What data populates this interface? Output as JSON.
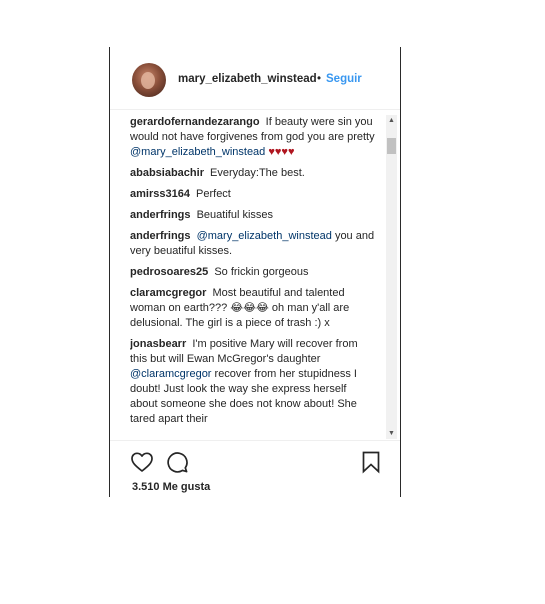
{
  "header": {
    "username": "mary_elizabeth_winstead",
    "separator": "•",
    "follow_label": "Seguir"
  },
  "comments": [
    {
      "author": "gerardofernandezarango",
      "text": "If beauty were sin you would not have forgivenes from god you are pretty",
      "mention": "@mary_elizabeth_winstead",
      "hearts": "♥♥♥♥"
    },
    {
      "author": "ababsiabachir",
      "text": "Everyday:The best."
    },
    {
      "author": "amirss3164",
      "text": "Perfect"
    },
    {
      "author": "anderfrings",
      "text": "Beuatiful kisses"
    },
    {
      "author": "anderfrings",
      "mention": "@mary_elizabeth_winstead",
      "text": "you and very beuatiful kisses."
    },
    {
      "author": "pedrosoares25",
      "text": "So frickin gorgeous"
    },
    {
      "author": "claramcgregor",
      "text": "Most beautiful and talented woman on earth??? 😂😂😂 oh man y'all are delusional. The girl is a piece of trash :) x"
    },
    {
      "author": "jonasbearr",
      "text_before": "I'm positive Mary will recover from this but will Ewan McGregor's daughter",
      "mention": "@claramcgregor",
      "text_after": "recover from her stupidness I doubt! Just look the way she express herself about someone she does not know about! She tared apart their"
    }
  ],
  "actions": {
    "likes": "3.510 Me gusta"
  }
}
